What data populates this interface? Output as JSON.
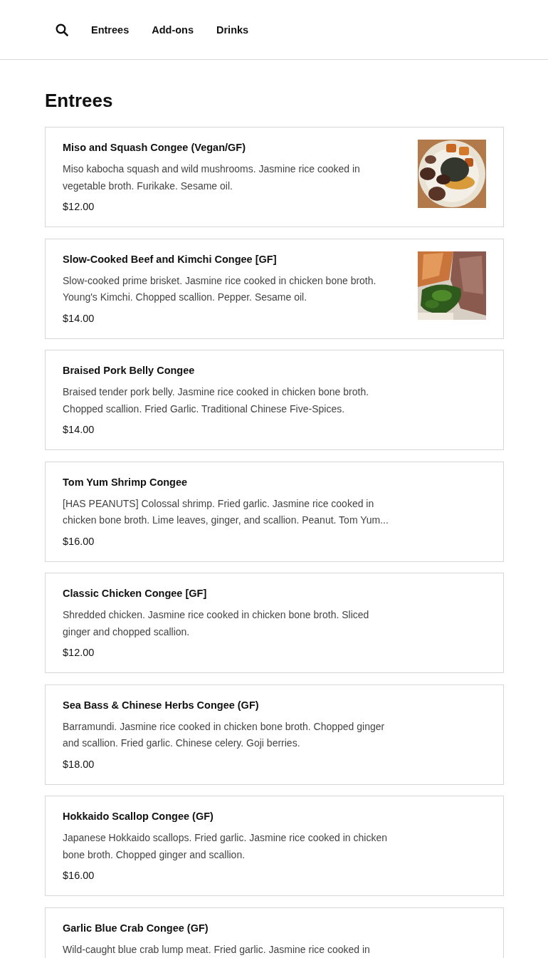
{
  "nav": {
    "items": [
      {
        "label": "Entrees"
      },
      {
        "label": "Add-ons"
      },
      {
        "label": "Drinks"
      }
    ]
  },
  "section": {
    "title": "Entrees"
  },
  "items": [
    {
      "name": "Miso and Squash Congee (Vegan/GF)",
      "description": "Miso kabocha squash and wild mushrooms. Jasmine rice cooked in vegetable broth. Furikake. Sesame oil.",
      "price": "$12.00"
    },
    {
      "name": "Slow-Cooked Beef and Kimchi Congee [GF]",
      "description": "Slow-cooked prime brisket. Jasmine rice cooked in chicken bone broth. Young's Kimchi. Chopped scallion. Pepper. Sesame oil.",
      "price": "$14.00"
    },
    {
      "name": "Braised Pork Belly Congee",
      "description": "Braised tender pork belly. Jasmine rice cooked in chicken bone broth. Chopped scallion. Fried Garlic. Traditional Chinese Five-Spices.",
      "price": "$14.00"
    },
    {
      "name": "Tom Yum Shrimp Congee",
      "description": "[HAS PEANUTS] Colossal shrimp. Fried garlic. Jasmine rice cooked in chicken bone broth. Lime leaves, ginger, and scallion. Peanut. Tom Yum...",
      "price": "$16.00"
    },
    {
      "name": "Classic Chicken Congee [GF]",
      "description": "Shredded chicken. Jasmine rice cooked in chicken bone broth. Sliced ginger and chopped scallion.",
      "price": "$12.00"
    },
    {
      "name": "Sea Bass & Chinese Herbs Congee (GF)",
      "description": "Barramundi. Jasmine rice cooked in chicken bone broth. Chopped ginger and scallion. Fried garlic. Chinese celery. Goji berries.",
      "price": "$18.00"
    },
    {
      "name": "Hokkaido Scallop Congee (GF)",
      "description": "Japanese Hokkaido scallops. Fried garlic. Jasmine rice cooked in chicken bone broth. Chopped ginger and scallion.",
      "price": "$16.00"
    },
    {
      "name": "Garlic Blue Crab Congee (GF)",
      "description": "Wild-caught blue crab lump meat. Fried garlic. Jasmine rice cooked in"
    }
  ]
}
